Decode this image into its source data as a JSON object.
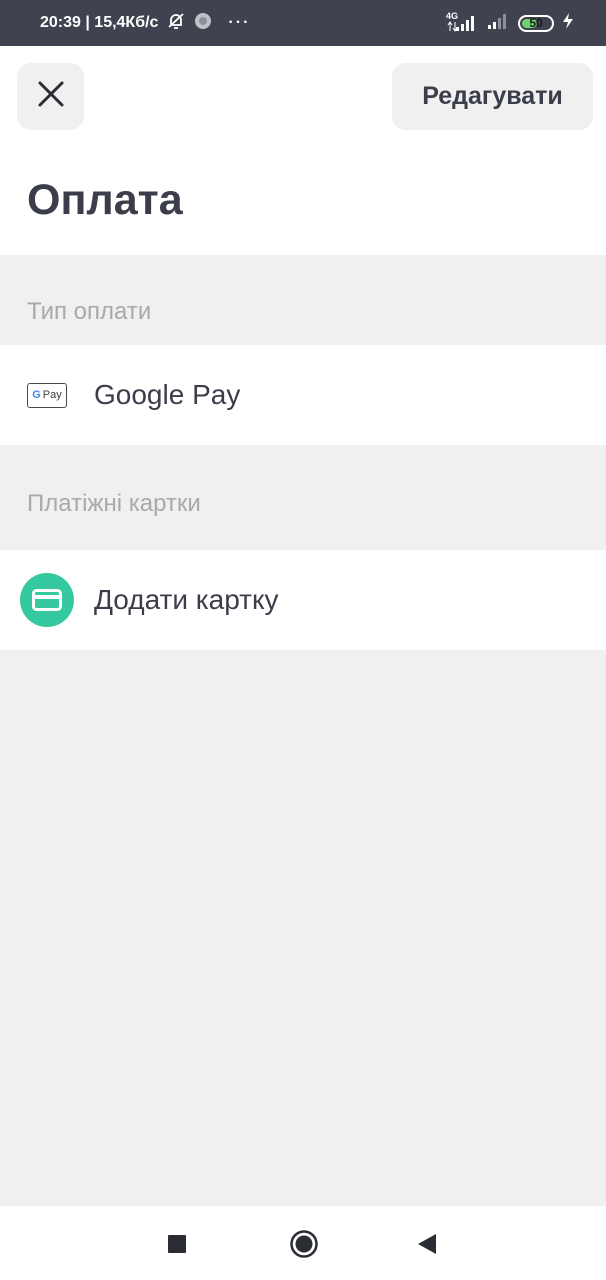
{
  "status_bar": {
    "time_speed": "20:39 | 15,4Кб/с",
    "dots": "···",
    "network_label": "4G",
    "battery_level": "50",
    "battery_fraction": 0.5
  },
  "header": {
    "close_icon": "close-icon",
    "edit_label": "Редагувати",
    "title": "Оплата"
  },
  "sections": [
    {
      "header": "Тип оплати",
      "items": [
        {
          "icon": "google-pay-icon",
          "badge_g": "G",
          "badge_text": "Pay",
          "label": "Google Pay"
        }
      ]
    },
    {
      "header": "Платіжні картки",
      "items": [
        {
          "icon": "credit-card-icon",
          "label": "Додати картку"
        }
      ]
    }
  ],
  "navigation": {
    "recents": "square-icon",
    "home": "circle-icon",
    "back": "triangle-back-icon"
  },
  "colors": {
    "status_bar": "#3f4350",
    "accent_green": "#36c9a0",
    "text_dark": "#3b3e4a",
    "text_muted": "#a7a9ad",
    "background": "#f0f0f0"
  }
}
